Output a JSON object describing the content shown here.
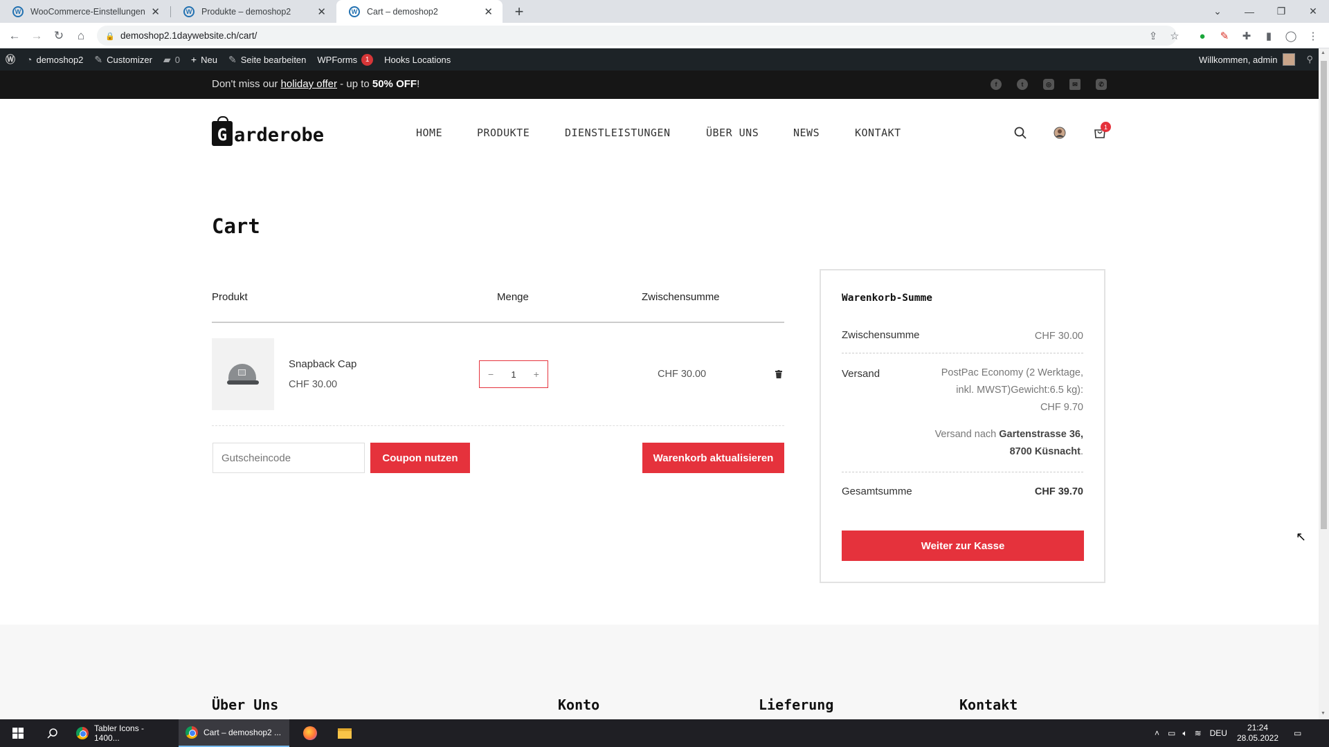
{
  "browser": {
    "tabs": [
      {
        "title": "WooCommerce-Einstellungen ‹ d"
      },
      {
        "title": "Produkte – demoshop2"
      },
      {
        "title": "Cart – demoshop2"
      }
    ],
    "url": "demoshop2.1daywebsite.ch/cart/"
  },
  "adminbar": {
    "site": "demoshop2",
    "customizer": "Customizer",
    "comments": "0",
    "new": "Neu",
    "edit": "Seite bearbeiten",
    "wpforms": "WPForms",
    "wpforms_badge": "1",
    "hooks": "Hooks Locations",
    "welcome": "Willkommen, admin"
  },
  "promo": {
    "prefix": "Don't miss our ",
    "link": "holiday offer",
    "middle": " - up to ",
    "highlight": "50% OFF",
    "suffix": "!"
  },
  "header": {
    "logo_letter": "G",
    "logo_text": "arderobe",
    "nav": [
      "HOME",
      "PRODUKTE",
      "DIENSTLEISTUNGEN",
      "ÜBER UNS",
      "NEWS",
      "KONTAKT"
    ],
    "cart_count": "1"
  },
  "cart": {
    "title": "Cart",
    "columns": {
      "product": "Produkt",
      "qty": "Menge",
      "subtotal": "Zwischensumme"
    },
    "item": {
      "name": "Snapback Cap",
      "price": "CHF 30.00",
      "quantity": "1",
      "subtotal": "CHF 30.00"
    },
    "coupon_placeholder": "Gutscheincode",
    "coupon_button": "Coupon nutzen",
    "update_button": "Warenkorb aktualisieren"
  },
  "totals": {
    "title": "Warenkorb-Summe",
    "subtotal_label": "Zwischensumme",
    "subtotal_value": "CHF 30.00",
    "shipping_label": "Versand",
    "shipping_line1": "PostPac Economy (2 Werktage,",
    "shipping_line2": "inkl. MWST)Gewicht:6.5 kg):",
    "shipping_line3": "CHF 9.70",
    "shipping_to_prefix": "Versand nach ",
    "shipping_to_addr1": "Gartenstrasse 36,",
    "shipping_to_addr2": "8700 Küsnacht",
    "total_label": "Gesamtsumme",
    "total_value": "CHF 39.70",
    "checkout_button": "Weiter zur Kasse"
  },
  "footer": {
    "headings": [
      "Über Uns",
      "Konto",
      "Lieferung",
      "Kontakt"
    ]
  },
  "taskbar": {
    "items": [
      "Tabler Icons - 1400...",
      "Cart – demoshop2 ..."
    ],
    "lang": "DEU",
    "time": "21:24",
    "date": "28.05.2022"
  },
  "colors": {
    "accent": "#e5323c",
    "adminbar": "#1d2327",
    "promo": "#161616"
  }
}
